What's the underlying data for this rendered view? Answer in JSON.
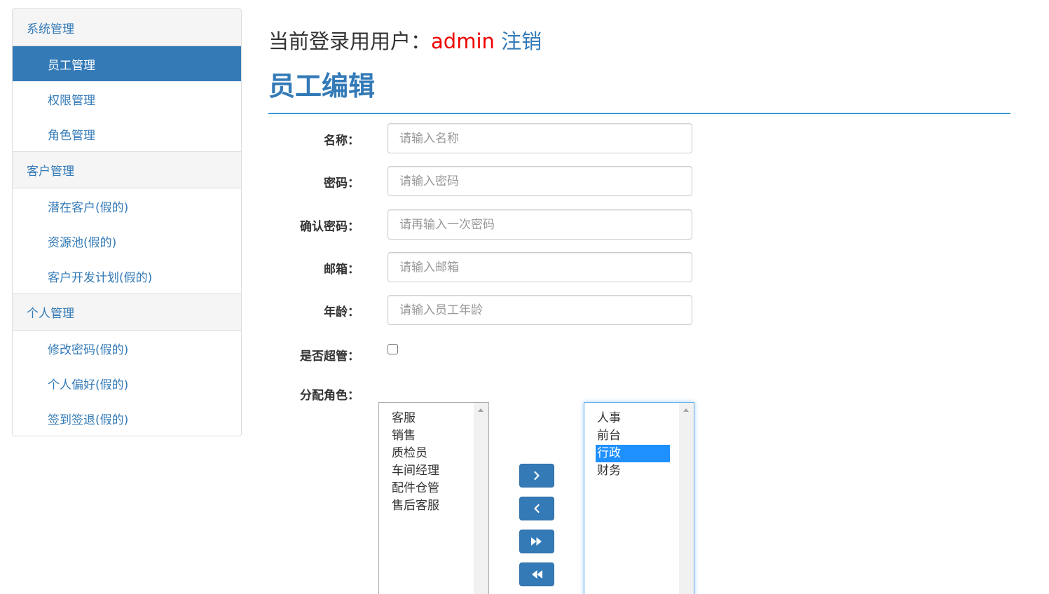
{
  "sidebar": {
    "groups": [
      {
        "title": "系统管理",
        "items": [
          "员工管理",
          "权限管理",
          "角色管理"
        ]
      },
      {
        "title": "客户管理",
        "items": [
          "潜在客户(假的)",
          "资源池(假的)",
          "客户开发计划(假的)"
        ]
      },
      {
        "title": "个人管理",
        "items": [
          "修改密码(假的)",
          "个人偏好(假的)",
          "签到签退(假的)"
        ]
      }
    ],
    "active_item": "员工管理"
  },
  "header": {
    "login_prefix": "当前登录用用户：",
    "username": "admin",
    "logout": "注销"
  },
  "page_title": "员工编辑",
  "form": {
    "name": {
      "label": "名称：",
      "placeholder": "请输入名称",
      "value": ""
    },
    "password": {
      "label": "密码：",
      "placeholder": "请输入密码",
      "value": ""
    },
    "confirm_password": {
      "label": "确认密码：",
      "placeholder": "请再输入一次密码",
      "value": ""
    },
    "email": {
      "label": "邮箱：",
      "placeholder": "请输入邮箱",
      "value": ""
    },
    "age": {
      "label": "年龄：",
      "placeholder": "请输入员工年龄",
      "value": ""
    },
    "is_admin": {
      "label": "是否超管：",
      "checked": false
    },
    "roles": {
      "label": "分配角色："
    }
  },
  "roles": {
    "available": [
      "客服",
      "销售",
      "质检员",
      "车间经理",
      "配件仓管",
      "售后客服"
    ],
    "assigned": [
      "人事",
      "前台",
      "行政",
      "财务"
    ],
    "assigned_selected": "行政"
  },
  "colors": {
    "primary": "#337ab7",
    "username": "#e00000",
    "divider": "#3a98d8",
    "selected_option": "#1e90ff"
  },
  "icons": {
    "move_right": "chevron-right-icon",
    "move_left": "chevron-left-icon",
    "move_all_right": "double-forward-icon",
    "move_all_left": "double-backward-icon"
  }
}
